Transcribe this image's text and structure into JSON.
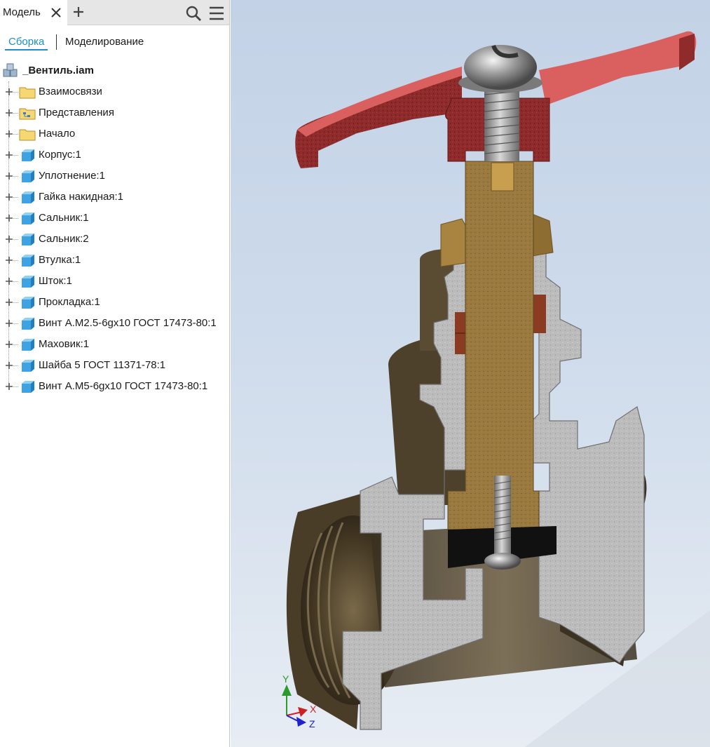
{
  "browser": {
    "tab_label": "Модель",
    "view_tabs": [
      "Сборка",
      "Моделирование"
    ]
  },
  "tree": {
    "root": "_Вентиль.iam",
    "items": [
      {
        "label": "Взаимосвязи",
        "icon": "folder-icon"
      },
      {
        "label": "Представления",
        "icon": "representations-folder-icon"
      },
      {
        "label": "Начало",
        "icon": "folder-icon"
      },
      {
        "label": "Корпус:1",
        "icon": "part-icon"
      },
      {
        "label": "Уплотнение:1",
        "icon": "part-icon"
      },
      {
        "label": "Гайка накидная:1",
        "icon": "part-icon"
      },
      {
        "label": "Сальник:1",
        "icon": "part-icon"
      },
      {
        "label": "Сальник:2",
        "icon": "part-icon"
      },
      {
        "label": "Втулка:1",
        "icon": "part-icon"
      },
      {
        "label": "Шток:1",
        "icon": "part-icon"
      },
      {
        "label": "Прокладка:1",
        "icon": "part-icon"
      },
      {
        "label": "Винт А.М2.5-6gx10 ГОСТ 17473-80:1",
        "icon": "part-icon"
      },
      {
        "label": "Маховик:1",
        "icon": "part-icon"
      },
      {
        "label": "Шайба 5 ГОСТ 11371-78:1",
        "icon": "part-icon"
      },
      {
        "label": "Винт А.М5-6gx10 ГОСТ 17473-80:1",
        "icon": "part-icon"
      }
    ]
  },
  "axis_triad": {
    "x": "X",
    "y": "Y",
    "z": "Z"
  },
  "colors": {
    "accent": "#1a8fc7",
    "handwheel": "#d9605f",
    "section_gray": "#bdbdbd",
    "bronze": "#5a4a32",
    "stem": "#9a7a3e",
    "viewport_top": "#c3d2e6"
  }
}
